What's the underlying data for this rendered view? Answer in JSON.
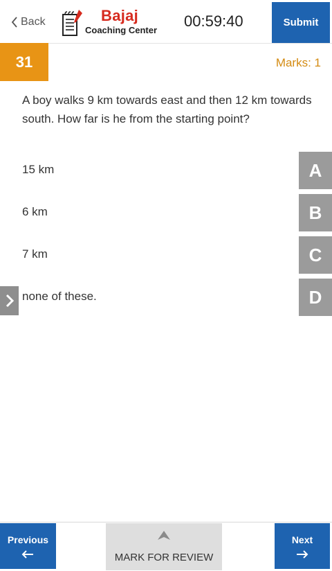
{
  "header": {
    "back_label": "Back",
    "brand_name": "Bajaj",
    "brand_sub": "Coaching Center",
    "timer": "00:59:40",
    "submit_label": "Submit"
  },
  "question": {
    "number": "31",
    "marks": "Marks: 1",
    "text": "A boy walks 9 km towards east and then 12 km towards south. How far is he from the starting point?"
  },
  "options": [
    {
      "letter": "A",
      "text": "15 km"
    },
    {
      "letter": "B",
      "text": "6 km"
    },
    {
      "letter": "C",
      "text": "7 km"
    },
    {
      "letter": "D",
      "text": "none of these."
    }
  ],
  "footer": {
    "previous_label": "Previous",
    "review_label": "MARK FOR REVIEW",
    "next_label": "Next"
  },
  "colors": {
    "primary": "#1e63b0",
    "accent": "#e89415",
    "brand_red": "#d62a1e",
    "option_bg": "#9b9b9b"
  },
  "icons": {
    "back": "chevron-left-icon",
    "logo": "notepad-pen-icon",
    "side_toggle": "chevron-right-icon",
    "previous": "arrow-left-icon",
    "next": "arrow-right-icon",
    "review": "flag-icon"
  }
}
